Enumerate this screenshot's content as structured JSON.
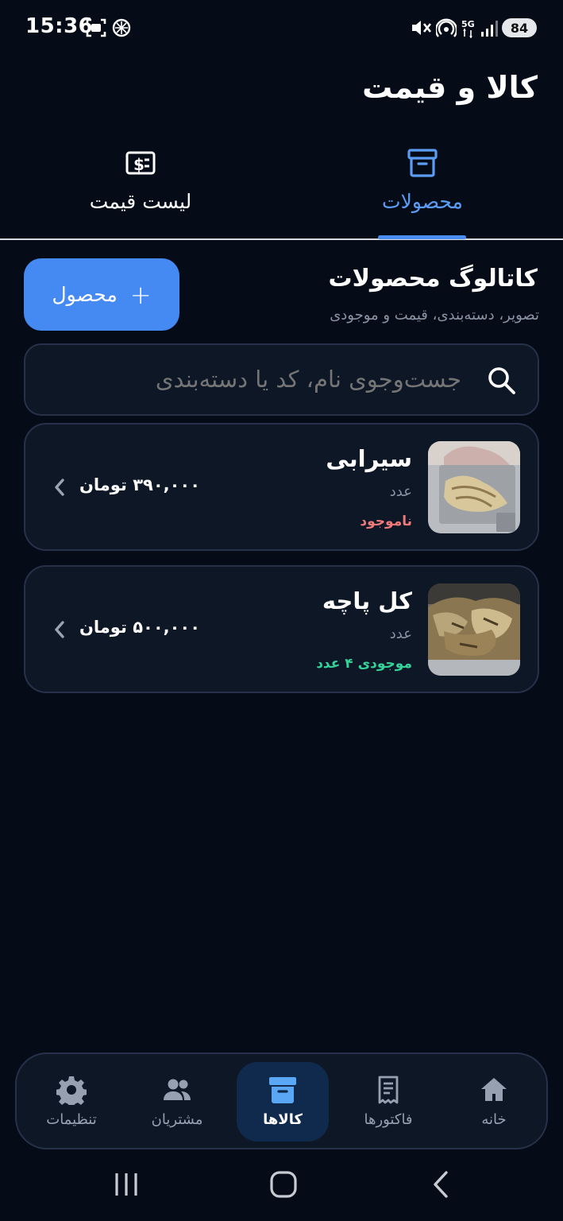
{
  "status_bar": {
    "time": "15:36",
    "battery": "84"
  },
  "app_title": "کالا و قیمت",
  "tabs": [
    {
      "label": "محصولات",
      "icon": "archive-box-icon",
      "active": true
    },
    {
      "label": "لیست قیمت",
      "icon": "price-tag-icon",
      "active": false
    }
  ],
  "section": {
    "title": "کاتالوگ محصولات",
    "subtitle": "تصویر، دسته‌بندی، قیمت و موجودی"
  },
  "add_button": {
    "plus": "+",
    "label": "محصول"
  },
  "search": {
    "placeholder": "جست‌وجوی نام، کد یا دسته‌بندی"
  },
  "products": [
    {
      "name": "سیرابی",
      "unit": "عدد",
      "stock_text": "ناموجود",
      "price": "۳۹۰,۰۰۰ تومان",
      "stock_color": "#f07a7a"
    },
    {
      "name": "کل پاچه",
      "unit": "عدد",
      "stock_text": "موجودی ۴ عدد",
      "price": "۵۰۰,۰۰۰ تومان",
      "stock_color": "#34d399"
    }
  ],
  "bottom_nav": [
    {
      "label": "خانه",
      "icon": "home-icon"
    },
    {
      "label": "فاکتورها",
      "icon": "receipt-icon"
    },
    {
      "label": "کالاها",
      "icon": "archive-box-icon",
      "active": true
    },
    {
      "label": "مشتریان",
      "icon": "users-icon"
    },
    {
      "label": "تنظیمات",
      "icon": "gear-icon"
    }
  ],
  "colors": {
    "background": "#050b17",
    "accent": "#4589f2",
    "card": "#0e1726",
    "out_of_stock": "#f07a7a",
    "in_stock": "#34d399"
  }
}
